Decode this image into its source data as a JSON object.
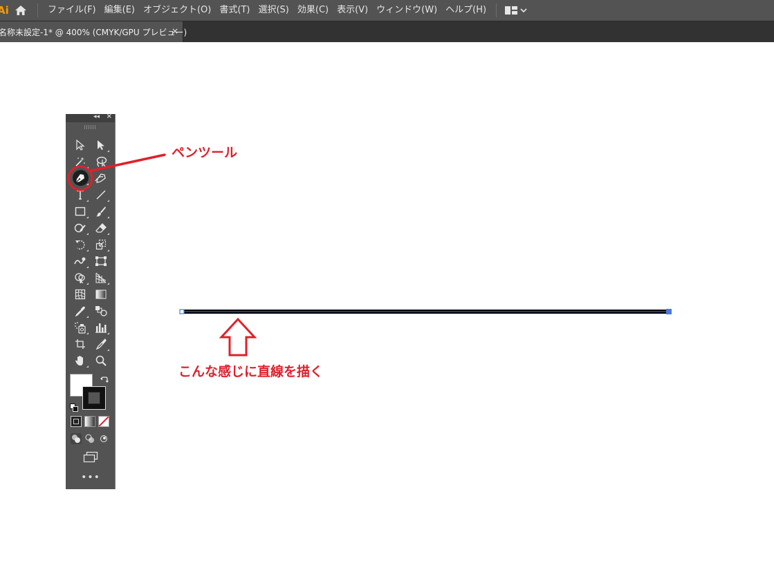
{
  "app": {
    "logo": "Ai"
  },
  "menu": {
    "items": [
      "ファイル(F)",
      "編集(E)",
      "オブジェクト(O)",
      "書式(T)",
      "選択(S)",
      "効果(C)",
      "表示(V)",
      "ウィンドウ(W)",
      "ヘルプ(H)"
    ]
  },
  "tab": {
    "title": "名称未設定-1* @ 400% (CMYK/GPU プレビュー)",
    "close": "×"
  },
  "toolpanel": {
    "collapse": "◂◂",
    "close": "×",
    "more": "•••"
  },
  "annotations": {
    "pen_tool_label": "ペンツール",
    "draw_line_label": "こんな感じに直線を描く"
  },
  "colors": {
    "menubar_bg": "#535353",
    "tabbar_bg": "#323232",
    "annotation_red": "#e0202a",
    "anchor_blue": "#4a78e0"
  }
}
